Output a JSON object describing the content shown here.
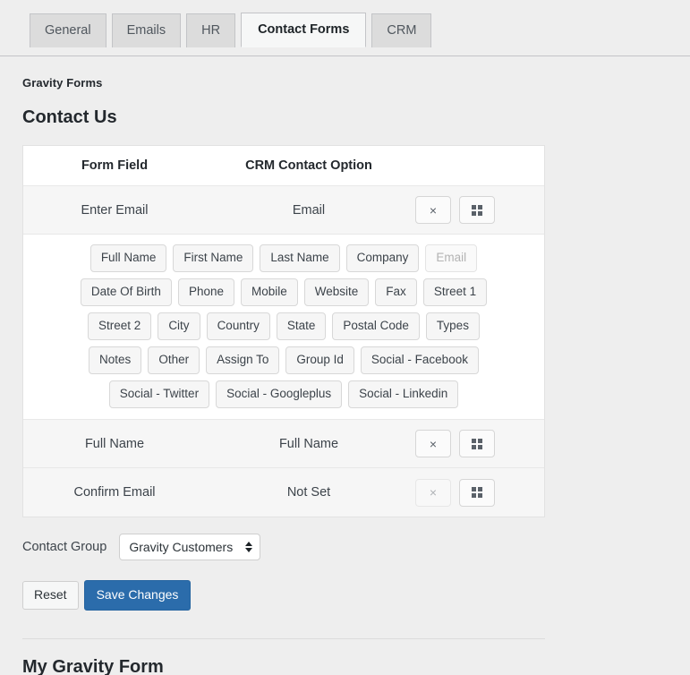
{
  "tabs": [
    {
      "label": "General",
      "active": false
    },
    {
      "label": "Emails",
      "active": false
    },
    {
      "label": "HR",
      "active": false
    },
    {
      "label": "Contact Forms",
      "active": true
    },
    {
      "label": "CRM",
      "active": false
    }
  ],
  "plugin_label": "Gravity Forms",
  "form_title": "Contact Us",
  "table": {
    "headers": {
      "form_field": "Form Field",
      "crm_option": "CRM Contact Option",
      "actions": ""
    },
    "rows": [
      {
        "form_field": "Enter Email",
        "crm_option": "Email",
        "remove_enabled": true,
        "choose_enabled": true,
        "expanded": true
      },
      {
        "form_field": "Full Name",
        "crm_option": "Full Name",
        "remove_enabled": true,
        "choose_enabled": true,
        "expanded": false
      },
      {
        "form_field": "Confirm Email",
        "crm_option": "Not Set",
        "remove_enabled": false,
        "choose_enabled": true,
        "expanded": false
      }
    ],
    "remove_icon": "close-x-icon",
    "remove_glyph": "×",
    "choose_icon": "grid-icon"
  },
  "field_picker": {
    "rows": [
      [
        {
          "label": "Full Name",
          "disabled": false
        },
        {
          "label": "First Name",
          "disabled": false
        },
        {
          "label": "Last Name",
          "disabled": false
        },
        {
          "label": "Company",
          "disabled": false
        },
        {
          "label": "Email",
          "disabled": true
        }
      ],
      [
        {
          "label": "Date Of Birth",
          "disabled": false
        },
        {
          "label": "Phone",
          "disabled": false
        },
        {
          "label": "Mobile",
          "disabled": false
        },
        {
          "label": "Website",
          "disabled": false
        },
        {
          "label": "Fax",
          "disabled": false
        },
        {
          "label": "Street 1",
          "disabled": false
        }
      ],
      [
        {
          "label": "Street 2",
          "disabled": false
        },
        {
          "label": "City",
          "disabled": false
        },
        {
          "label": "Country",
          "disabled": false
        },
        {
          "label": "State",
          "disabled": false
        },
        {
          "label": "Postal Code",
          "disabled": false
        },
        {
          "label": "Types",
          "disabled": false
        }
      ],
      [
        {
          "label": "Notes",
          "disabled": false
        },
        {
          "label": "Other",
          "disabled": false
        },
        {
          "label": "Assign To",
          "disabled": false
        },
        {
          "label": "Group Id",
          "disabled": false
        },
        {
          "label": "Social - Facebook",
          "disabled": false
        }
      ],
      [
        {
          "label": "Social - Twitter",
          "disabled": false
        },
        {
          "label": "Social - Googleplus",
          "disabled": false
        },
        {
          "label": "Social - Linkedin",
          "disabled": false
        }
      ]
    ]
  },
  "contact_group": {
    "label": "Contact Group",
    "selected": "Gravity Customers",
    "options": [
      "Gravity Customers"
    ]
  },
  "actions": {
    "reset_label": "Reset",
    "save_label": "Save Changes"
  },
  "next_form_title": "My Gravity Form",
  "colors": {
    "primary_button": "#2b6cab",
    "page_background": "#eeeeee",
    "row_background": "#f6f6f6",
    "active_tab_background": "#f6f7f7"
  }
}
